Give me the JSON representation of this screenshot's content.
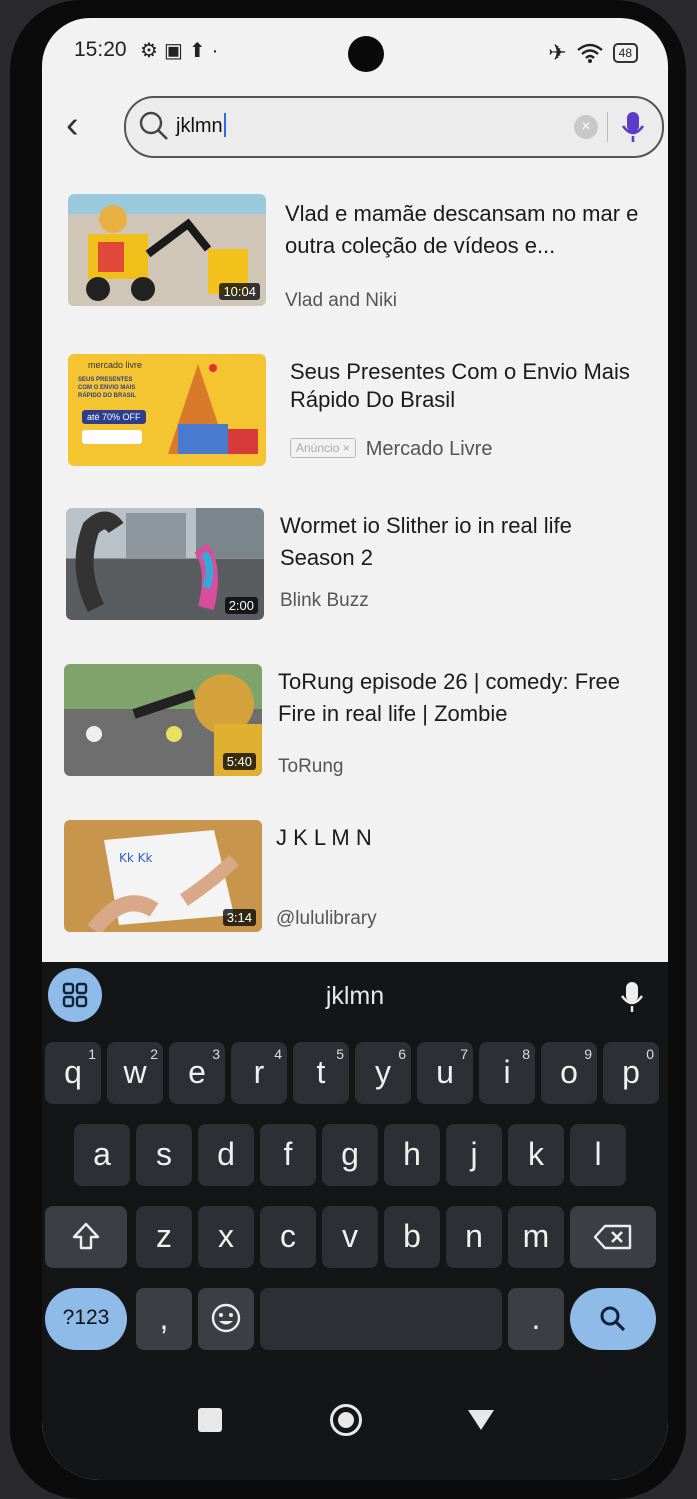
{
  "status": {
    "time": "15:20",
    "battery": "48"
  },
  "search": {
    "query": "jklmn"
  },
  "results": [
    {
      "title": "Vlad e mamãe descansam no mar e outra coleção de vídeos e...",
      "channel": "Vlad and Niki",
      "duration": "10:04"
    },
    {
      "title": "Seus Presentes Com o Envio Mais Rápido Do Brasil",
      "ad_badge": "Anúncio ×",
      "channel": "Mercado Livre"
    },
    {
      "title": "Wormet io Slither io in real life Season 2",
      "channel": "Blink Buzz",
      "duration": "2:00"
    },
    {
      "title": "ToRung episode 26 | comedy: Free Fire in real life | Zombie",
      "channel": "ToRung",
      "duration": "5:40"
    },
    {
      "title": "J K L M N",
      "channel": "@lululibrary",
      "duration": "3:14"
    }
  ],
  "keyboard": {
    "suggestion": "jklmn",
    "row1": [
      "q",
      "w",
      "e",
      "r",
      "t",
      "y",
      "u",
      "i",
      "o",
      "p"
    ],
    "row1_hints": [
      "1",
      "2",
      "3",
      "4",
      "5",
      "6",
      "7",
      "8",
      "9",
      "0"
    ],
    "row2": [
      "a",
      "s",
      "d",
      "f",
      "g",
      "h",
      "j",
      "k",
      "l"
    ],
    "row3": [
      "z",
      "x",
      "c",
      "v",
      "b",
      "n",
      "m"
    ],
    "symbols_label": "?123",
    "comma": ",",
    "period": "."
  },
  "thumb_ad_text": {
    "logo": "mercado livre",
    "line": "SEUS PRESENTES COM O ENVIO MAIS RÁPIDO DO BRASIL",
    "discount": "até 70% OFF"
  },
  "colors": {
    "accent": "#8ebbe8",
    "keyboard_bg": "#131517",
    "key": "#2c2f33"
  }
}
